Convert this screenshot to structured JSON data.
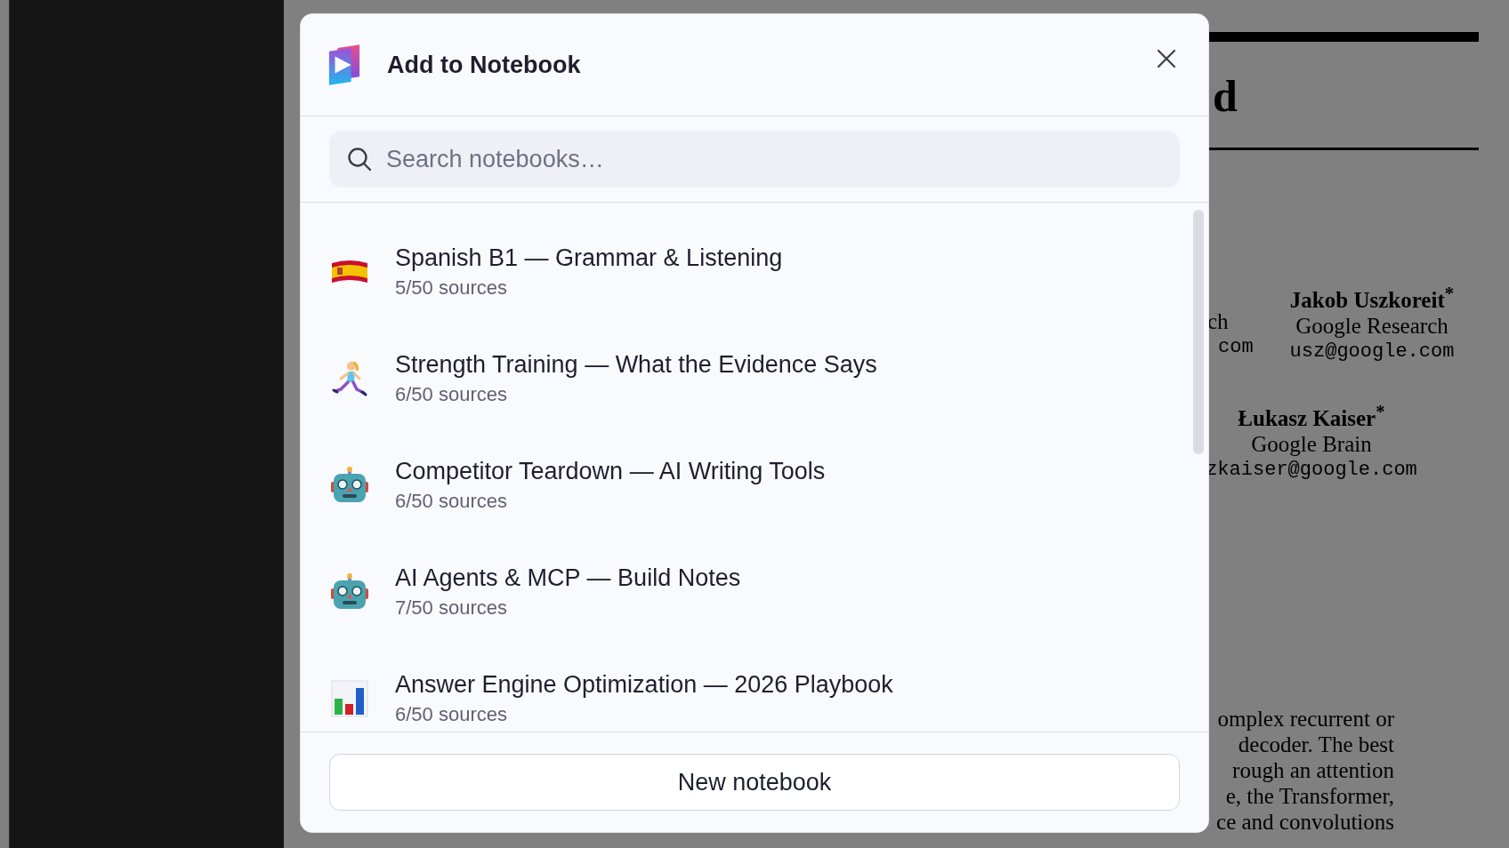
{
  "background_document": {
    "heading_fragment": "d",
    "authors": [
      {
        "name": "Jakob Uszkoreit$^{*}$",
        "affiliation": "Google Research",
        "email": "usz@google.com"
      },
      {
        "name": "Łukasz Kaiser$^{*}$",
        "affiliation": "Google Brain",
        "email": "zkaiser@google.com"
      }
    ],
    "cut_fragments": [
      "ch",
      "com"
    ],
    "abstract_lines": [
      "omplex recurrent or",
      "decoder.  The best",
      "rough an attention",
      "e, the Transformer,",
      "ce and convolutions"
    ]
  },
  "dialog": {
    "title": "Add to Notebook",
    "search": {
      "placeholder": "Search notebooks…"
    },
    "notebooks": [
      {
        "kind": "flag",
        "title": "Spanish B1 — Grammar & Listening",
        "sources": "5/50 sources"
      },
      {
        "kind": "runner",
        "title": "Strength Training — What the Evidence Says",
        "sources": "6/50 sources"
      },
      {
        "kind": "robot",
        "title": "Competitor Teardown — AI Writing Tools",
        "sources": "6/50 sources"
      },
      {
        "kind": "robot",
        "title": "AI Agents & MCP — Build Notes",
        "sources": "7/50 sources"
      },
      {
        "kind": "chart",
        "title": "Answer Engine Optimization — 2026 Playbook",
        "sources": "6/50 sources"
      }
    ],
    "button": "New notebook"
  }
}
